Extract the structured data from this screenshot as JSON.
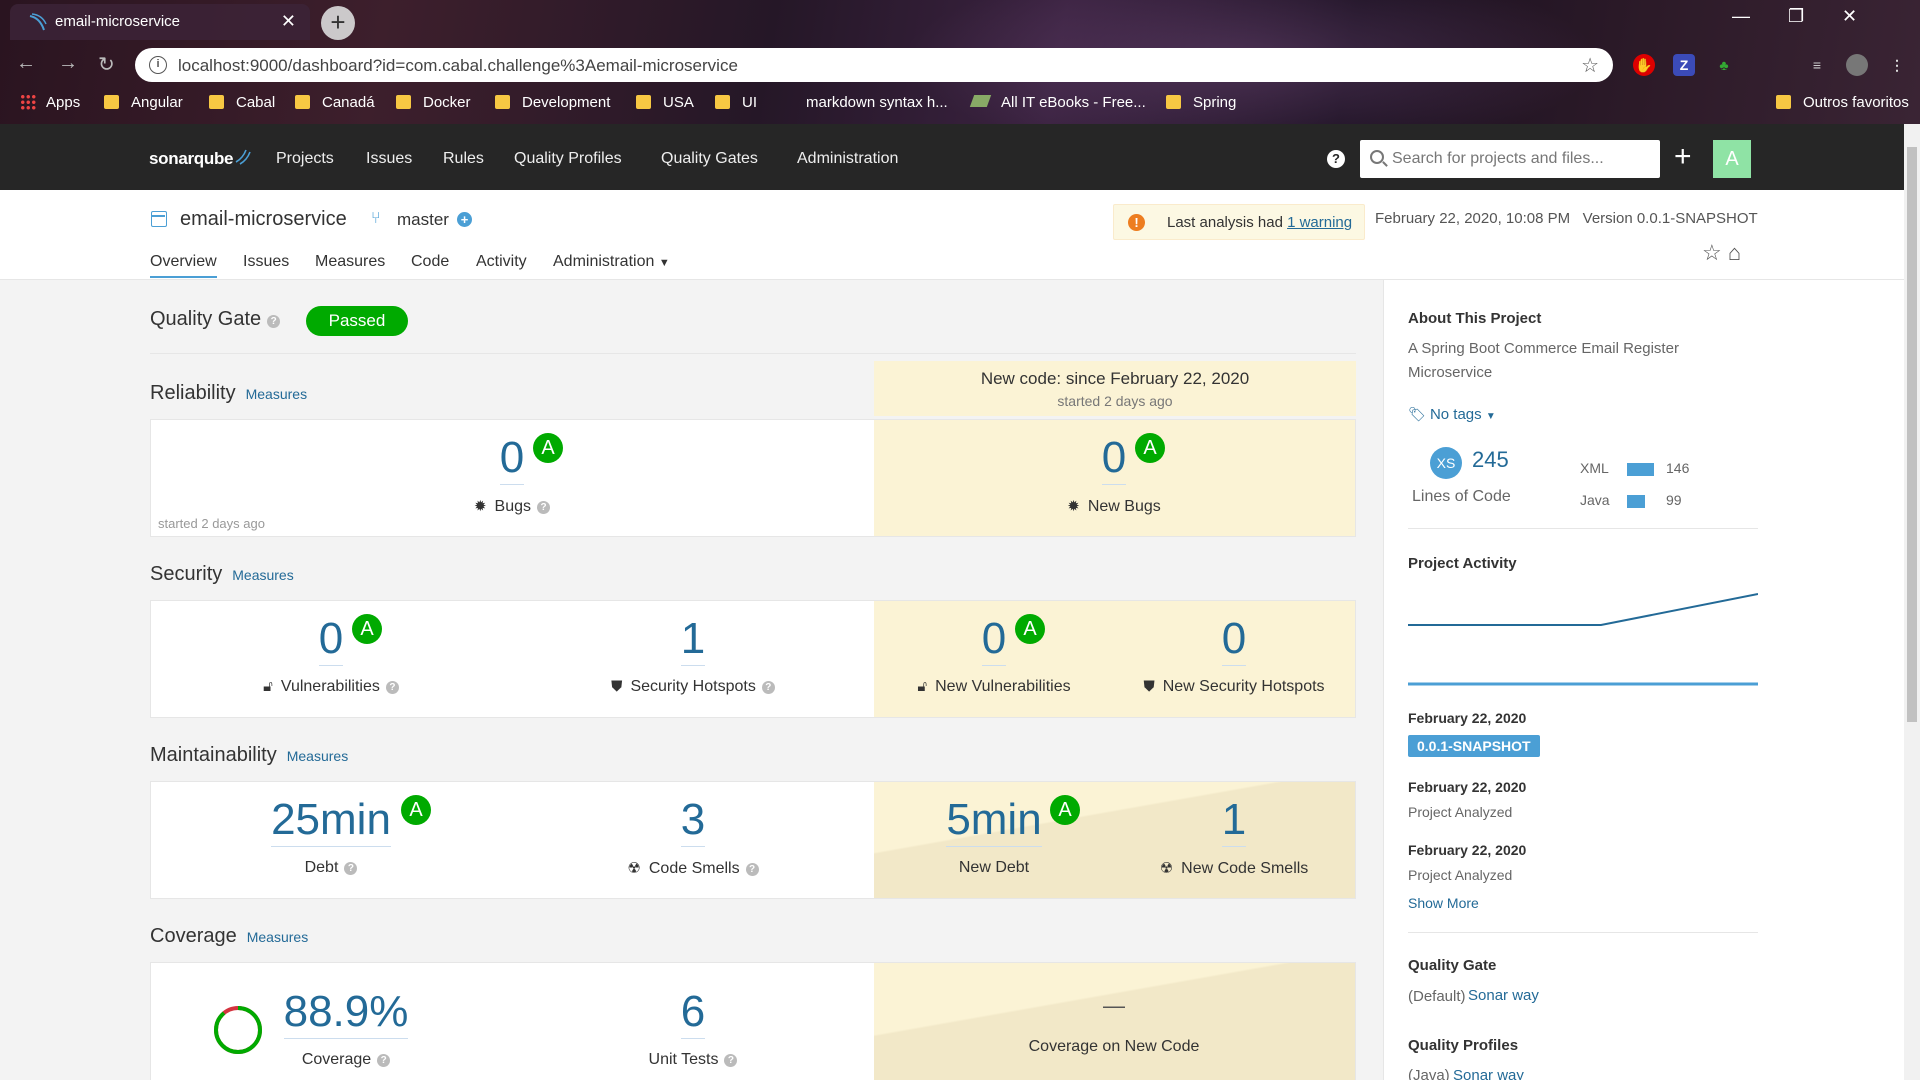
{
  "browser": {
    "tab_title": "email-microservice",
    "url": "localhost:9000/dashboard?id=com.cabal.challenge%3Aemail-microservice",
    "bookmarks": [
      "Apps",
      "Angular",
      "Cabal",
      "Canadá",
      "Docker",
      "Development",
      "USA",
      "UI",
      "markdown syntax h...",
      "All IT eBooks - Free...",
      "Spring"
    ],
    "other_bookmarks": "Outros favoritos",
    "ext_z": "Z"
  },
  "nav": {
    "logo": "sonarqube",
    "links": [
      "Projects",
      "Issues",
      "Rules",
      "Quality Profiles",
      "Quality Gates",
      "Administration"
    ],
    "help": "?",
    "search_placeholder": "Search for projects and files...",
    "avatar": "A"
  },
  "project": {
    "name": "email-microservice",
    "branch": "master",
    "warning_prefix": "Last analysis had",
    "warning_link": "1 warning",
    "date": "February 22, 2020, 10:08 PM",
    "version": "Version 0.0.1-SNAPSHOT",
    "tabs": [
      "Overview",
      "Issues",
      "Measures",
      "Code",
      "Activity",
      "Administration"
    ]
  },
  "overview": {
    "quality_gate_label": "Quality Gate",
    "quality_gate_status": "Passed",
    "new_code_title": "New code: since February 22, 2020",
    "new_code_sub": "started 2 days ago",
    "measures_link": "Measures",
    "reliability": {
      "title": "Reliability",
      "started": "started 2 days ago",
      "bugs": "0",
      "bugs_rating": "A",
      "bugs_label": "Bugs",
      "new_bugs": "0",
      "new_bugs_rating": "A",
      "new_bugs_label": "New Bugs"
    },
    "security": {
      "title": "Security",
      "vulnerabilities": "0",
      "vuln_rating": "A",
      "vuln_label": "Vulnerabilities",
      "hotspots": "1",
      "hotspots_label": "Security Hotspots",
      "new_vulnerabilities": "0",
      "new_vuln_rating": "A",
      "new_vuln_label": "New Vulnerabilities",
      "new_hotspots": "0",
      "new_hotspots_label": "New Security Hotspots"
    },
    "maintainability": {
      "title": "Maintainability",
      "debt": "25min",
      "debt_rating": "A",
      "debt_label": "Debt",
      "smells": "3",
      "smells_label": "Code Smells",
      "new_debt": "5min",
      "new_debt_rating": "A",
      "new_debt_label": "New Debt",
      "new_smells": "1",
      "new_smells_label": "New Code Smells"
    },
    "coverage": {
      "title": "Coverage",
      "coverage": "88.9%",
      "coverage_fraction": 0.889,
      "coverage_label": "Coverage",
      "unit_tests": "6",
      "unit_tests_label": "Unit Tests",
      "new_coverage": "—",
      "new_coverage_label": "Coverage on New Code"
    }
  },
  "sidebar": {
    "about_title": "About This Project",
    "description": "A Spring Boot Commerce Email Register Microservice",
    "tags": "No tags",
    "size_badge": "XS",
    "loc": "245",
    "loc_label": "Lines of Code",
    "languages": [
      {
        "name": "XML",
        "value": "146"
      },
      {
        "name": "Java",
        "value": "99"
      }
    ],
    "activity_title": "Project Activity",
    "events": [
      {
        "date": "February 22, 2020",
        "badge": "0.0.1-SNAPSHOT"
      },
      {
        "date": "February 22, 2020",
        "text": "Project Analyzed"
      },
      {
        "date": "February 22, 2020",
        "text": "Project Analyzed"
      }
    ],
    "show_more": "Show More",
    "quality_gate_title": "Quality Gate",
    "qg_default": "(Default)",
    "qg_name": "Sonar way",
    "quality_profiles_title": "Quality Profiles",
    "qp_lang": "(Java)",
    "qp_name": "Sonar way"
  },
  "colors": {
    "accent": "#4b9fd5",
    "passed": "#00aa00",
    "link": "#236a97",
    "new_code_bg": "#fbf3d5"
  }
}
